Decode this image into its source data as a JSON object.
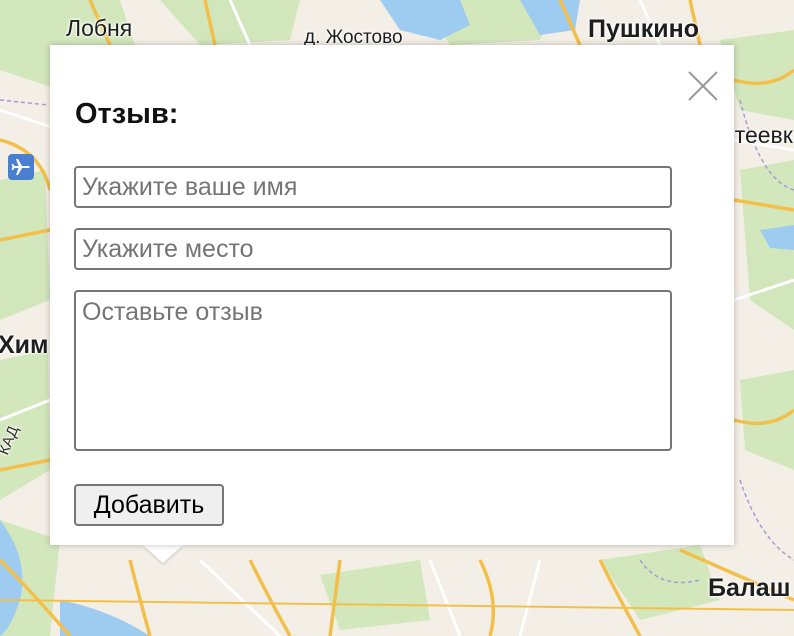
{
  "map": {
    "labels": {
      "lobnya": "Лобня",
      "zhostovo": "д. Жостово",
      "pushkino": "Пушкино",
      "ivanteevka_partial": "нтеевка",
      "khimki_partial": "Хим",
      "mkad_partial": "КАД",
      "balashikha_partial": "Балаш"
    },
    "colors": {
      "background": "#f3efe6",
      "forest": "#cfe6b8",
      "water": "#9ecbf0",
      "major_road": "#f2c04a",
      "minor_road": "#ffffff",
      "boundary": "#a79ad6"
    }
  },
  "popup": {
    "title": "Отзыв:",
    "close_icon": "close-icon",
    "name_input": {
      "placeholder": "Укажите ваше имя",
      "value": ""
    },
    "place_input": {
      "placeholder": "Укажите место",
      "value": ""
    },
    "review_textarea": {
      "placeholder": "Оставьте отзыв",
      "value": ""
    },
    "add_button_label": "Добавить"
  }
}
